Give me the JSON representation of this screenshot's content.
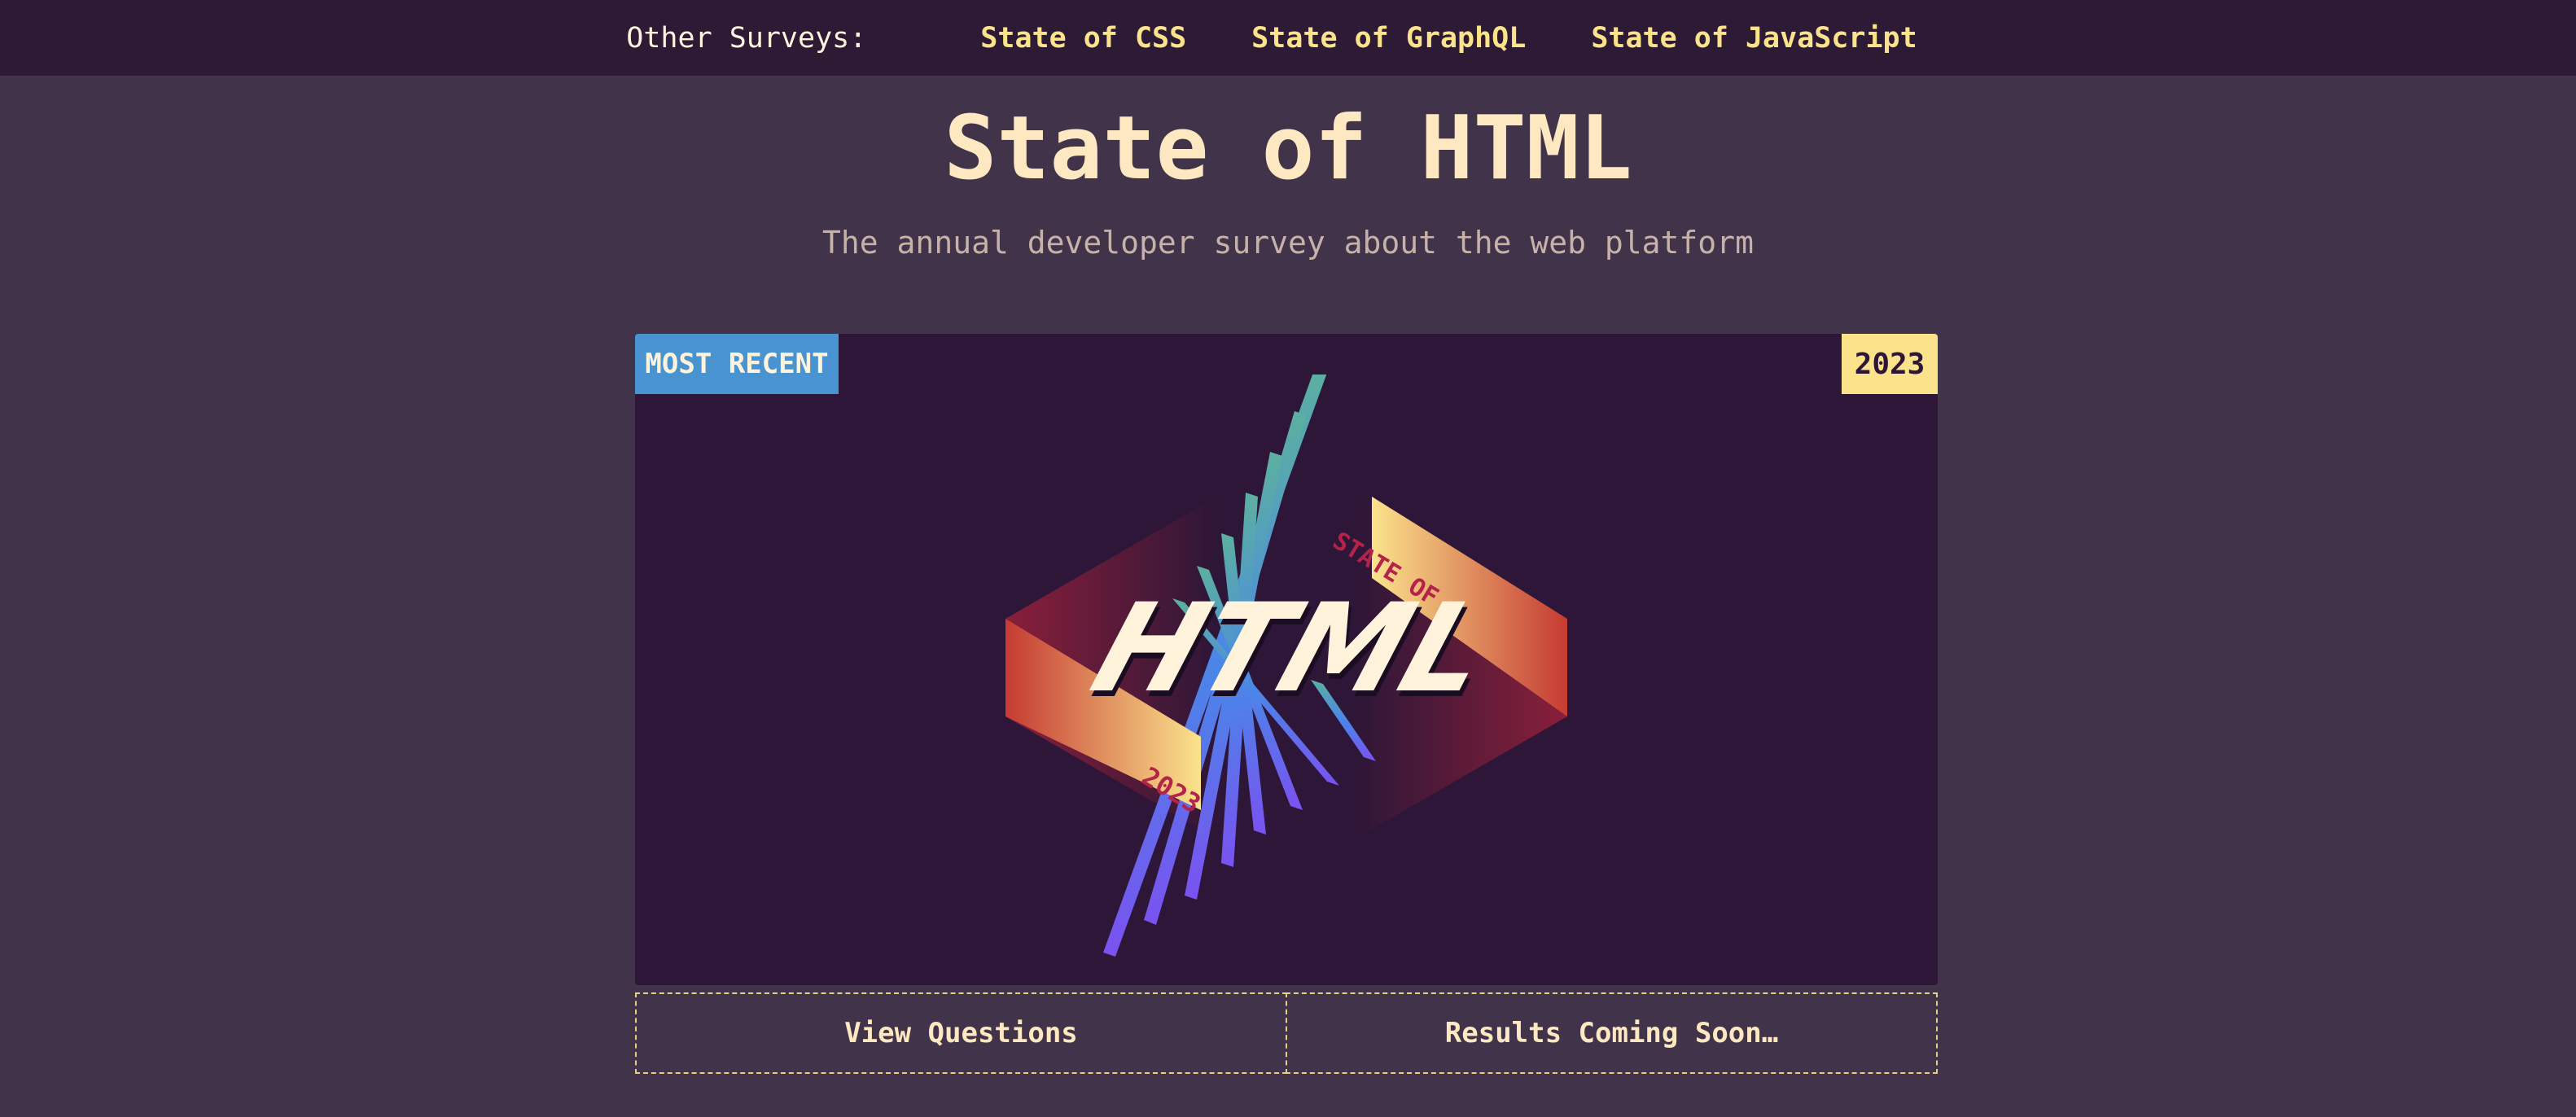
{
  "topbar": {
    "label": "Other Surveys:",
    "links": [
      "State of CSS",
      "State of GraphQL",
      "State of JavaScript"
    ]
  },
  "header": {
    "title": "State of HTML",
    "subtitle": "The annual developer survey about the web platform"
  },
  "card": {
    "badge_recent": "MOST RECENT",
    "badge_year": "2023",
    "logo": {
      "main_text": "HTML",
      "ribbon_top": "STATE OF",
      "ribbon_bottom": "2023"
    }
  },
  "actions": {
    "view_questions": "View Questions",
    "results": "Results Coming Soon…"
  },
  "colors": {
    "accent_yellow": "#fbe38c",
    "badge_blue": "#4994d0",
    "card_bg": "#2d1637",
    "page_bg": "#41334a"
  }
}
